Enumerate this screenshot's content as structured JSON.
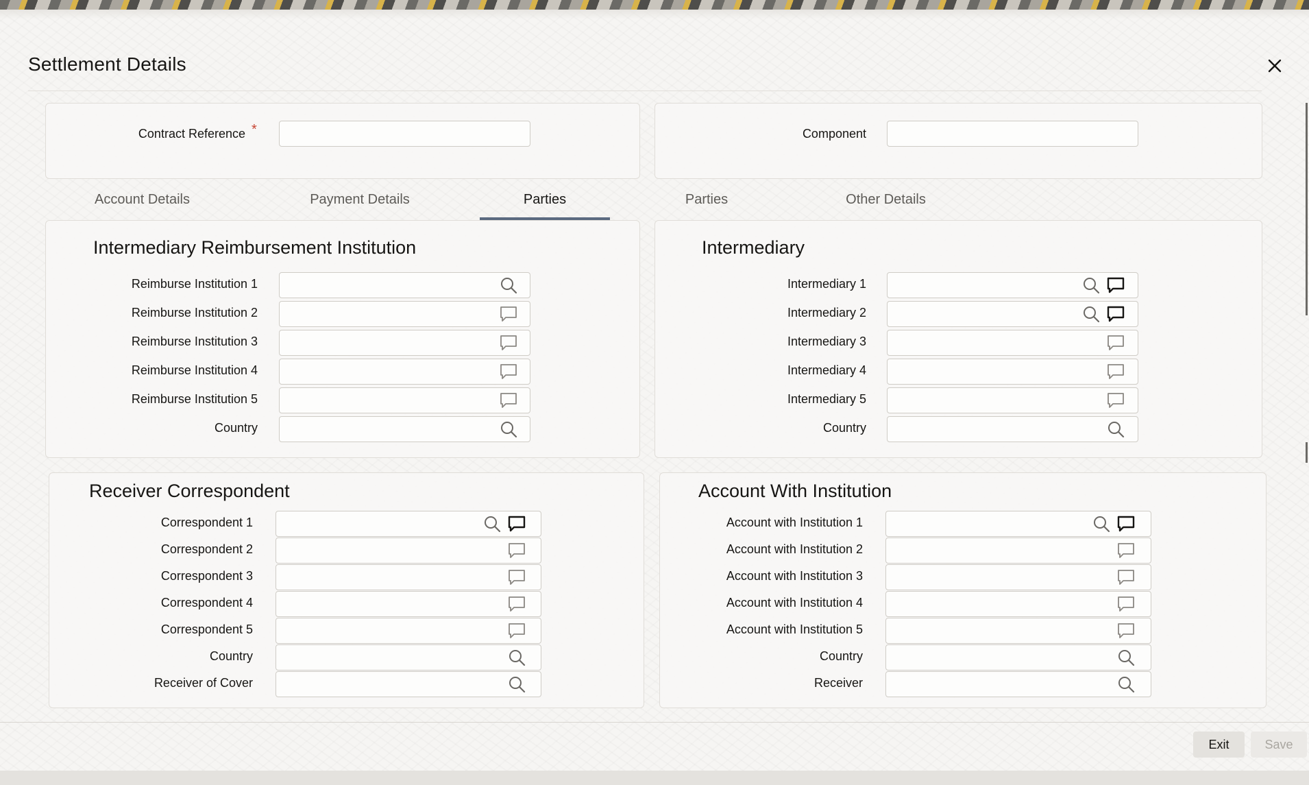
{
  "window": {
    "title": "Settlement Details",
    "close_icon": "close-icon"
  },
  "header_fields": {
    "contract_reference": {
      "label": "Contract Reference",
      "required_mark": "*",
      "value": ""
    },
    "component": {
      "label": "Component",
      "value": ""
    }
  },
  "tabs": [
    {
      "label": "Account Details",
      "active": false
    },
    {
      "label": "Payment Details",
      "active": false
    },
    {
      "label": "Parties",
      "active": true
    },
    {
      "label": "Parties",
      "active": false
    },
    {
      "label": "Other Details",
      "active": false
    }
  ],
  "sections": {
    "reimbursement": {
      "title": "Intermediary Reimbursement Institution",
      "fields": [
        {
          "label": "Reimburse Institution 1",
          "value": "",
          "icons": [
            "search-icon"
          ]
        },
        {
          "label": "Reimburse Institution 2",
          "value": "",
          "icons": [
            "comment-icon"
          ]
        },
        {
          "label": "Reimburse Institution 3",
          "value": "",
          "icons": [
            "comment-icon"
          ]
        },
        {
          "label": "Reimburse Institution 4",
          "value": "",
          "icons": [
            "comment-icon"
          ]
        },
        {
          "label": "Reimburse Institution 5",
          "value": "",
          "icons": [
            "comment-icon"
          ]
        },
        {
          "label": "Country",
          "value": "",
          "icons": [
            "search-icon"
          ]
        }
      ]
    },
    "intermediary": {
      "title": "Intermediary",
      "fields": [
        {
          "label": "Intermediary 1",
          "value": "",
          "icons": [
            "search-icon",
            "comment-icon"
          ]
        },
        {
          "label": "Intermediary 2",
          "value": "",
          "icons": [
            "search-icon",
            "comment-icon"
          ]
        },
        {
          "label": "Intermediary 3",
          "value": "",
          "icons": [
            "comment-icon"
          ]
        },
        {
          "label": "Intermediary 4",
          "value": "",
          "icons": [
            "comment-icon"
          ]
        },
        {
          "label": "Intermediary 5",
          "value": "",
          "icons": [
            "comment-icon"
          ]
        },
        {
          "label": "Country",
          "value": "",
          "icons": [
            "search-icon"
          ]
        }
      ]
    },
    "receiver_correspondent": {
      "title": "Receiver Correspondent",
      "fields": [
        {
          "label": "Correspondent 1",
          "value": "",
          "icons": [
            "search-icon",
            "comment-icon"
          ]
        },
        {
          "label": "Correspondent 2",
          "value": "",
          "icons": [
            "comment-icon"
          ]
        },
        {
          "label": "Correspondent 3",
          "value": "",
          "icons": [
            "comment-icon"
          ]
        },
        {
          "label": "Correspondent 4",
          "value": "",
          "icons": [
            "comment-icon"
          ]
        },
        {
          "label": "Correspondent 5",
          "value": "",
          "icons": [
            "comment-icon"
          ]
        },
        {
          "label": "Country",
          "value": "",
          "icons": [
            "search-icon"
          ]
        },
        {
          "label": "Receiver of Cover",
          "value": "",
          "icons": [
            "search-icon"
          ]
        }
      ]
    },
    "account_with_institution": {
      "title": "Account With Institution",
      "fields": [
        {
          "label": "Account with Institution 1",
          "value": "",
          "icons": [
            "search-icon",
            "comment-icon"
          ]
        },
        {
          "label": "Account with Institution 2",
          "value": "",
          "icons": [
            "comment-icon"
          ]
        },
        {
          "label": "Account with Institution 3",
          "value": "",
          "icons": [
            "comment-icon"
          ]
        },
        {
          "label": "Account with Institution 4",
          "value": "",
          "icons": [
            "comment-icon"
          ]
        },
        {
          "label": "Account with Institution 5",
          "value": "",
          "icons": [
            "comment-icon"
          ]
        },
        {
          "label": "Country",
          "value": "",
          "icons": [
            "search-icon"
          ]
        },
        {
          "label": "Receiver",
          "value": "",
          "icons": [
            "search-icon"
          ]
        }
      ]
    }
  },
  "footer": {
    "exit_label": "Exit",
    "save_label": "Save"
  },
  "colors": {
    "accent_tab": "#5b6a80",
    "required": "#c74634"
  }
}
